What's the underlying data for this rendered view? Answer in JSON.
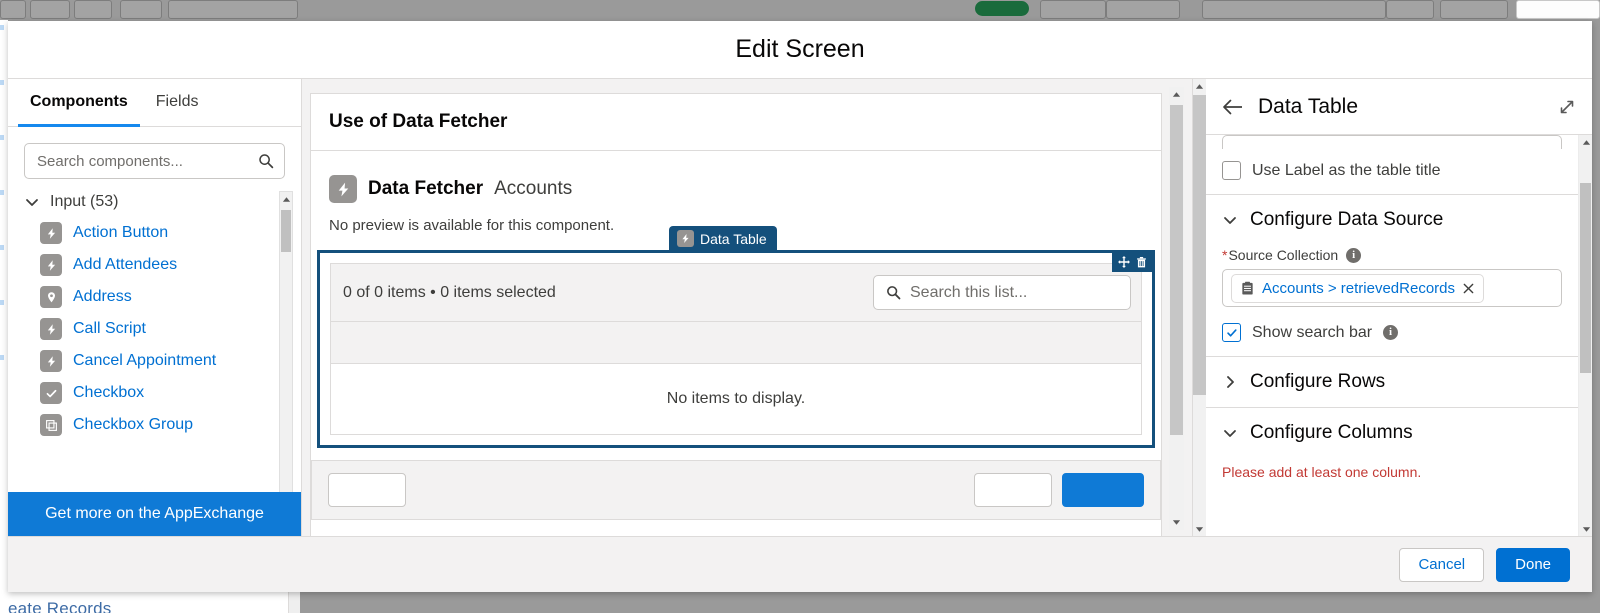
{
  "modal": {
    "title": "Edit Screen",
    "footer": {
      "cancel_label": "Cancel",
      "done_label": "Done"
    }
  },
  "sidebar": {
    "tabs": [
      {
        "label": "Components",
        "active": true
      },
      {
        "label": "Fields",
        "active": false
      }
    ],
    "search": {
      "placeholder": "Search components...",
      "value": "",
      "icon": "search-icon"
    },
    "group": {
      "label": "Input (53)",
      "expanded": true,
      "chevron": "chevron-down-icon"
    },
    "items": [
      {
        "label": "Action Button",
        "icon": "lightning-icon"
      },
      {
        "label": "Add Attendees",
        "icon": "lightning-icon"
      },
      {
        "label": "Address",
        "icon": "location-pin-icon"
      },
      {
        "label": "Call Script",
        "icon": "lightning-icon"
      },
      {
        "label": "Cancel Appointment",
        "icon": "lightning-icon"
      },
      {
        "label": "Checkbox",
        "icon": "checkmark-icon"
      },
      {
        "label": "Checkbox Group",
        "icon": "checkbox-group-icon"
      }
    ],
    "appexchange_label": "Get more on the AppExchange"
  },
  "canvas": {
    "screen_title": "Use of Data Fetcher",
    "fetcher": {
      "name": "Data Fetcher",
      "object": "Accounts",
      "icon": "lightning-icon",
      "no_preview_text": "No preview is available for this component."
    },
    "data_table": {
      "flag_label": "Data Table",
      "flag_icon": "lightning-icon",
      "actions": {
        "move_icon": "move-icon",
        "delete_icon": "trash-icon"
      },
      "count_text": "0 of 0 items • 0 items selected",
      "search_placeholder": "Search this list...",
      "search_icon": "search-icon",
      "empty_text": "No items to display."
    }
  },
  "properties": {
    "back_icon": "arrow-left-icon",
    "title": "Data Table",
    "expand_icon": "expand-icon",
    "use_label_checkbox": {
      "label": "Use Label as the table title",
      "checked": false
    },
    "data_source_section": {
      "title": "Configure Data Source",
      "expanded": true,
      "chevron": "chevron-down-icon",
      "source_collection": {
        "label": "Source Collection",
        "required": true,
        "info_icon": "info-icon",
        "pill_icon": "record-collection-icon",
        "pill_text": "Accounts > retrievedRecords",
        "remove_icon": "close-icon"
      },
      "show_search_bar": {
        "label": "Show search bar",
        "checked": true,
        "info_icon": "info-icon"
      }
    },
    "rows_section": {
      "title": "Configure Rows",
      "expanded": false,
      "chevron": "chevron-right-icon"
    },
    "columns_section": {
      "title": "Configure Columns",
      "expanded": true,
      "chevron": "chevron-down-icon",
      "error_text": "Please add at least one column."
    }
  },
  "background": {
    "bottom_text": "eate Records",
    "accent_blue": "#0070d2",
    "selection_navy": "#14507c",
    "error_red": "#c23934"
  }
}
